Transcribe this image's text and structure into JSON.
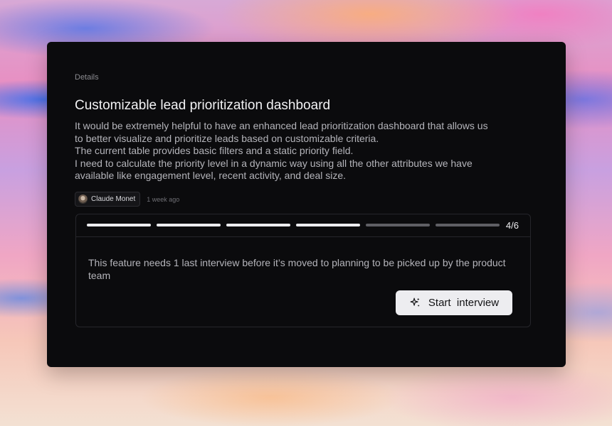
{
  "breadcrumb": "Details",
  "title": "Customizable lead prioritization dashboard",
  "description": [
    "It would be extremely helpful to have an enhanced lead prioritization dashboard that allows us",
    "to better visualize and prioritize leads based on customizable criteria.",
    "The current table provides basic filters and a static priority field.",
    "I need to calculate the priority level in a dynamic way using all the other attributes we have",
    "available like engagement level, recent activity, and deal size."
  ],
  "author": {
    "name": "Claude Monet",
    "posted": "1 week ago"
  },
  "progress": {
    "completed": 4,
    "total": 6,
    "label": "4/6"
  },
  "message": "This feature needs 1 last interview before it’s moved to planning to be picked up by the product team",
  "start_button": {
    "label": "Start  interview",
    "icon": "sparkle-icon"
  },
  "colors": {
    "card": "#0b0b0d",
    "button": "#ededf0",
    "progress_done": "#ececef",
    "progress_todo": "#5f5f64"
  }
}
